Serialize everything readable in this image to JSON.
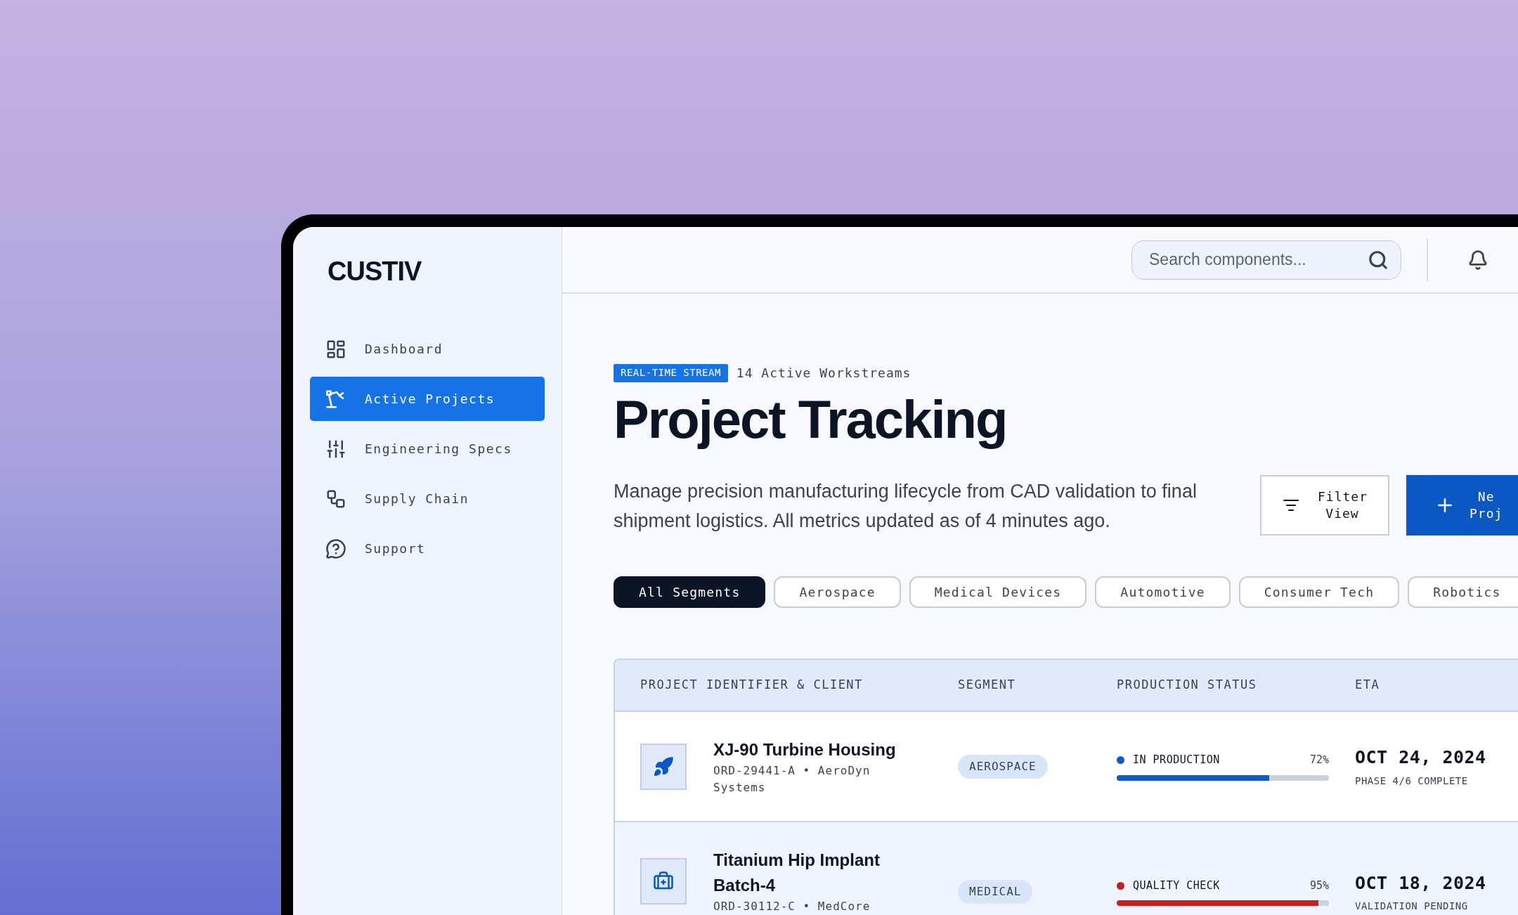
{
  "brand": "CUSTIV",
  "nav": [
    {
      "label": "Dashboard",
      "kind": "dashboard",
      "selected": false
    },
    {
      "label": "Active Projects",
      "kind": "robot",
      "selected": true
    },
    {
      "label": "Engineering Specs",
      "kind": "specs",
      "selected": false
    },
    {
      "label": "Supply Chain",
      "kind": "chain",
      "selected": false
    },
    {
      "label": "Support",
      "kind": "support",
      "selected": false
    }
  ],
  "search": {
    "placeholder": "Search components..."
  },
  "header": {
    "badge": "REAL-TIME STREAM",
    "subtitle": "14 Active Workstreams",
    "title": "Project Tracking",
    "description": "Manage precision manufacturing lifecycle from CAD validation to final shipment logistics. All metrics updated as of 4 minutes ago."
  },
  "filter_button": {
    "label": "Filter View"
  },
  "new_button": {
    "label_lines": [
      "Ne",
      "Proj"
    ]
  },
  "segments": [
    {
      "label": "All Segments",
      "selected": true
    },
    {
      "label": "Aerospace",
      "selected": false
    },
    {
      "label": "Medical Devices",
      "selected": false
    },
    {
      "label": "Automotive",
      "selected": false
    },
    {
      "label": "Consumer Tech",
      "selected": false
    },
    {
      "label": "Robotics",
      "selected": false
    }
  ],
  "table": {
    "columns": [
      "PROJECT IDENTIFIER & CLIENT",
      "SEGMENT",
      "PRODUCTION STATUS",
      "ETA"
    ],
    "rows": [
      {
        "kind": "rocket",
        "title": "XJ-90 Turbine Housing",
        "subtitle": "ORD-29441-A • AeroDyn Systems",
        "segment": "AEROSPACE",
        "status": "IN PRODUCTION",
        "color": "#0b5cc8",
        "percent": "72%",
        "level": 0.72,
        "eta": "OCT 24, 2024",
        "eta_note": "PHASE 4/6 COMPLETE"
      },
      {
        "kind": "medical",
        "title": "Titanium Hip Implant Batch-4",
        "subtitle": "ORD-30112-C • MedCore",
        "segment": "MEDICAL",
        "status": "QUALITY CHECK",
        "color": "#c42020",
        "percent": "95%",
        "level": 0.95,
        "eta": "OCT 18, 2024",
        "eta_note": "VALIDATION PENDING"
      }
    ]
  }
}
